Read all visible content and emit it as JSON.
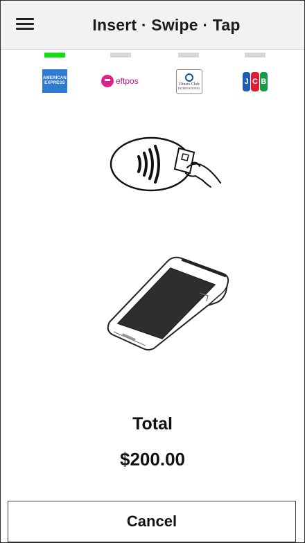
{
  "header": {
    "title": "Insert · Swipe · Tap",
    "menu_icon": "hamburger-menu-icon"
  },
  "brands": [
    {
      "name": "American Express",
      "logo_text": "AMERICAN EXPRESS",
      "icon": "amex-logo-icon",
      "active": true,
      "color": "#2e7bd1"
    },
    {
      "name": "eftpos",
      "logo_text": "eftpos",
      "icon": "eftpos-logo-icon",
      "active": false,
      "color": "#e0218a"
    },
    {
      "name": "Diners Club",
      "logo_text": "Diners Club",
      "logo_subtext": "INTERNATIONAL",
      "icon": "diners-club-logo-icon",
      "active": false,
      "color": "#1b4fa0"
    },
    {
      "name": "JCB",
      "logo_letters": [
        "J",
        "C",
        "B"
      ],
      "icon": "jcb-logo-icon",
      "active": false,
      "colors": [
        "#1e5cb3",
        "#d91e36",
        "#169b45"
      ]
    }
  ],
  "indicator_colors": {
    "active": "#11dd11",
    "inactive": "#d8d8d8"
  },
  "illustrations": {
    "tap": "contactless-tap-icon",
    "terminal": "payment-terminal-icon"
  },
  "total": {
    "label": "Total",
    "amount": "$200.00"
  },
  "actions": {
    "cancel_label": "Cancel"
  }
}
